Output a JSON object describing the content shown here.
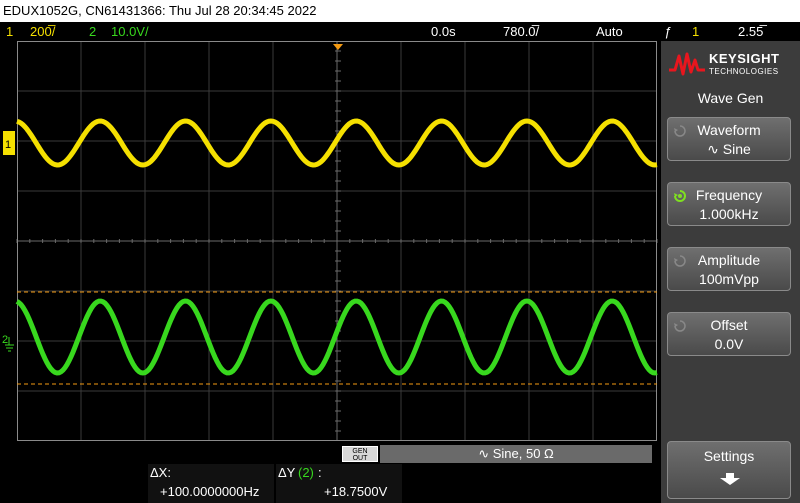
{
  "header": {
    "title": "EDUX1052G, CN61431366: Thu Jul 28 20:34:45 2022"
  },
  "status": {
    "ch1_num": "1",
    "ch1_scale": "200̅/",
    "ch2_num": "2",
    "ch2_scale": "10.0V/",
    "time_delay": "0.0s",
    "time_scale": "780.0̅/",
    "trigger_mode": "Auto",
    "trigger_icon": "ƒ",
    "trigger_source": "1",
    "trigger_level": "2.55̅",
    "trigger_colors": {
      "ch1": "#f5e000",
      "ch2": "#38d81e"
    }
  },
  "brand": {
    "name": "KEYSIGHT",
    "sub": "TECHNOLOGIES",
    "logo_color": "#e8161e"
  },
  "panel": {
    "title": "Wave Gen",
    "softkeys": [
      {
        "label": "Waveform",
        "value": "∿ Sine",
        "active": false
      },
      {
        "label": "Frequency",
        "value": "1.000kHz",
        "active": true
      },
      {
        "label": "Amplitude",
        "value": "100mVpp",
        "active": false
      },
      {
        "label": "Offset",
        "value": "0.0V",
        "active": false
      }
    ],
    "settings": {
      "label": "Settings"
    }
  },
  "gen": {
    "button_top": "GEN",
    "button_bottom": "OUT",
    "info": "∿ Sine, 50 Ω"
  },
  "measure": {
    "dx_label": "ΔX:",
    "dx_value": "+100.0000000Hz",
    "dy_label": "ΔY",
    "dy_channel": "(2)",
    "dy_colon": ":",
    "dy_value": "+18.7500V"
  },
  "markers": {
    "ch1": "1",
    "ch2": "2"
  },
  "waveforms": {
    "cycles_on_screen": 7.5,
    "ch1_color": "#f5e000",
    "ch2_color": "#38d81e"
  }
}
